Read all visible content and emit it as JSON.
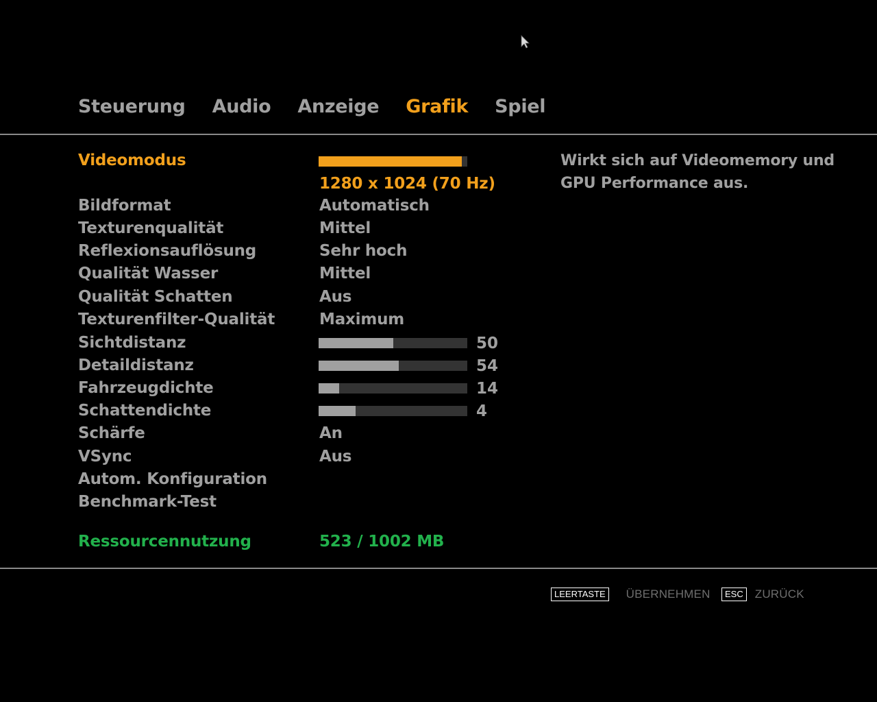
{
  "tabs": [
    {
      "label": "Steuerung",
      "active": false
    },
    {
      "label": "Audio",
      "active": false
    },
    {
      "label": "Anzeige",
      "active": false
    },
    {
      "label": "Grafik",
      "active": true
    },
    {
      "label": "Spiel",
      "active": false
    }
  ],
  "settings": {
    "videomodus": {
      "label": "Videomodus",
      "value": "1280 x 1024 (70 Hz)",
      "slider_fraction": 0.965
    },
    "bildformat": {
      "label": "Bildformat",
      "value": "Automatisch"
    },
    "texturenqualitaet": {
      "label": "Texturenqualität",
      "value": "Mittel"
    },
    "reflexionsaufloesung": {
      "label": "Reflexionsauflösung",
      "value": "Sehr hoch"
    },
    "qualitaet_wasser": {
      "label": "Qualität Wasser",
      "value": "Mittel"
    },
    "qualitaet_schatten": {
      "label": "Qualität Schatten",
      "value": "Aus"
    },
    "texturenfilter": {
      "label": "Texturenfilter-Qualität",
      "value": "Maximum"
    },
    "sichtdistanz": {
      "label": "Sichtdistanz",
      "value": "50",
      "fraction": 0.5
    },
    "detaildistanz": {
      "label": "Detaildistanz",
      "value": "54",
      "fraction": 0.54
    },
    "fahrzeugdichte": {
      "label": "Fahrzeugdichte",
      "value": "14",
      "fraction": 0.14
    },
    "schattendichte": {
      "label": "Schattendichte",
      "value": "4",
      "fraction": 0.25
    },
    "schaerfe": {
      "label": "Schärfe",
      "value": "An"
    },
    "vsync": {
      "label": "VSync",
      "value": "Aus"
    },
    "autom_konfiguration": {
      "label": "Autom. Konfiguration"
    },
    "benchmark": {
      "label": "Benchmark-Test"
    },
    "ressourcennutzung": {
      "label": "Ressourcennutzung",
      "value": "523 / 1002 MB"
    }
  },
  "description": "Wirkt sich auf Videomemory und GPU Performance aus.",
  "footer": {
    "apply_key": "LEERTASTE",
    "apply_label": "ÜBERNEHMEN",
    "back_key": "ESC",
    "back_label": "ZURÜCK"
  },
  "colors": {
    "accent": "#f2a01c",
    "text": "#a0a0a0",
    "resource": "#22b14c",
    "background": "#000000"
  }
}
